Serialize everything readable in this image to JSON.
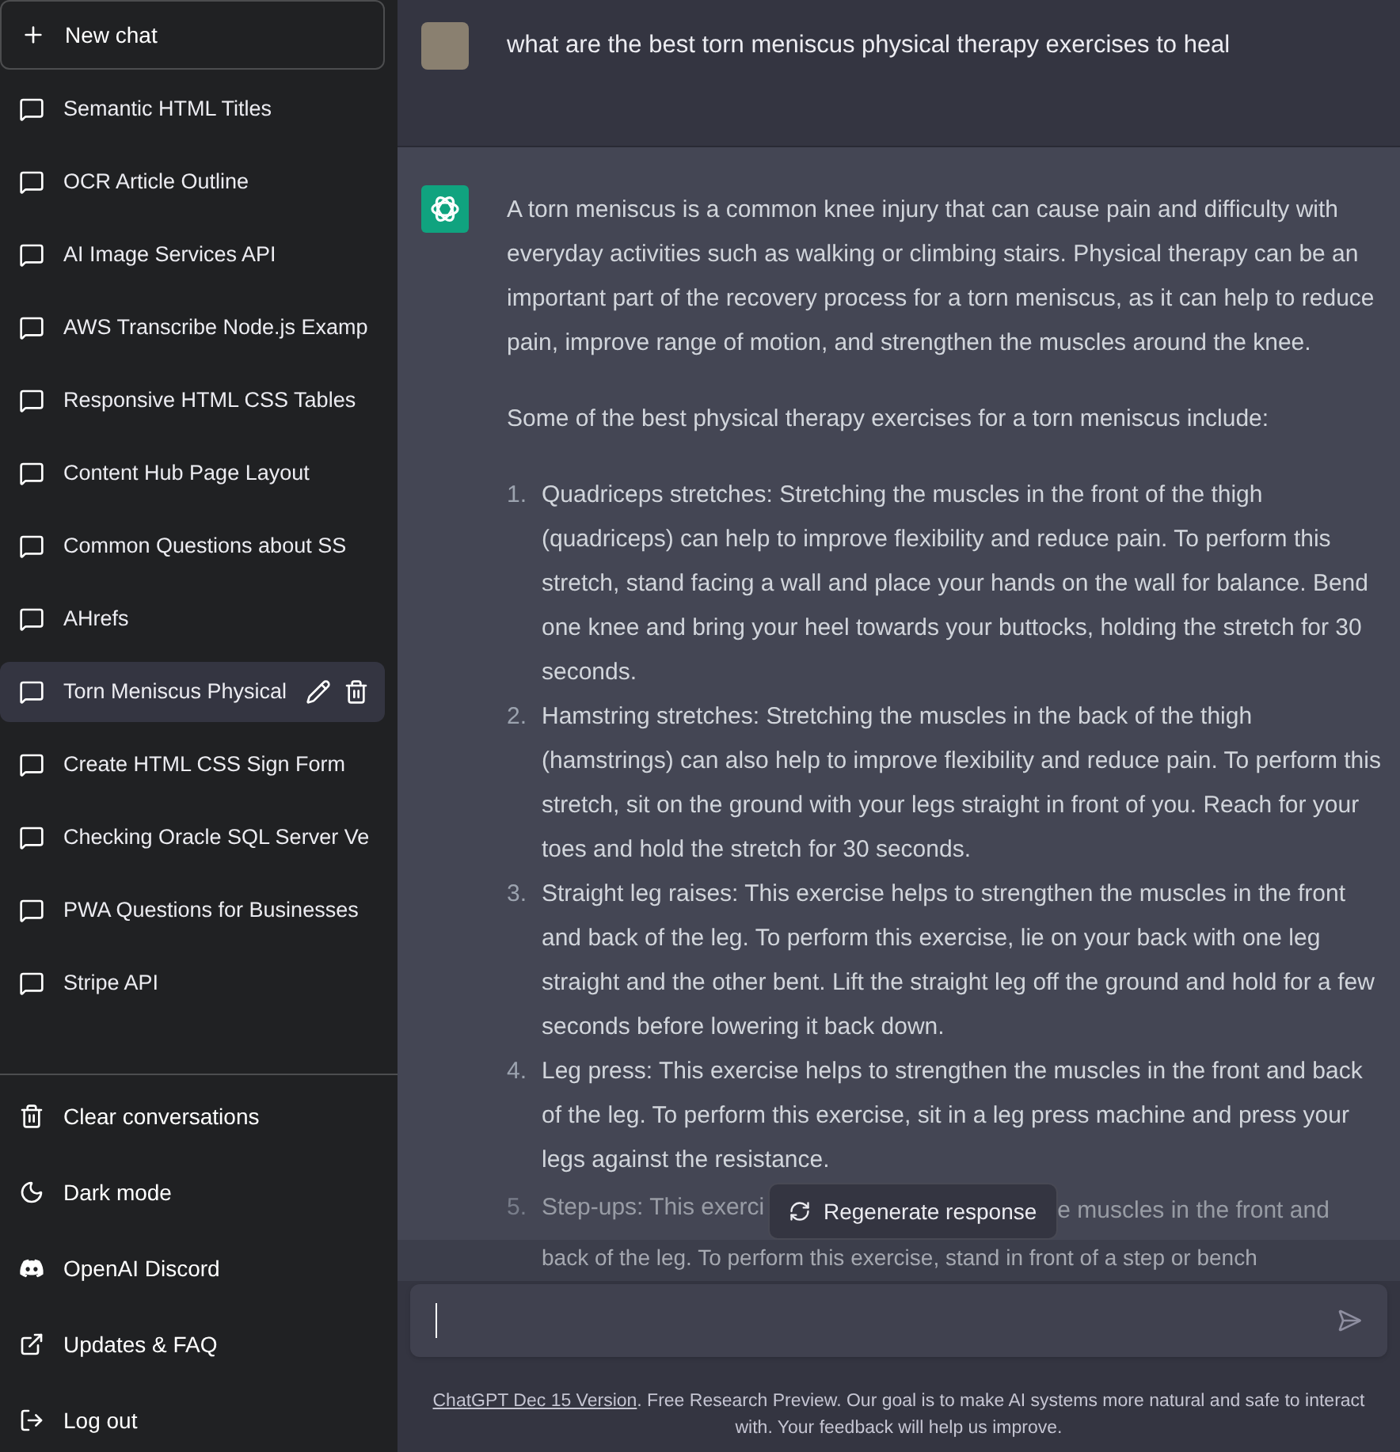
{
  "sidebar": {
    "new_chat": "New chat",
    "conversations": [
      {
        "title": "Semantic HTML Titles",
        "selected": false
      },
      {
        "title": "OCR Article Outline",
        "selected": false
      },
      {
        "title": "AI Image Services API",
        "selected": false
      },
      {
        "title": "AWS Transcribe Node.js Examp",
        "selected": false
      },
      {
        "title": "Responsive HTML CSS Tables",
        "selected": false
      },
      {
        "title": "Content Hub Page Layout",
        "selected": false
      },
      {
        "title": "Common Questions about SS",
        "selected": false
      },
      {
        "title": "AHrefs",
        "selected": false
      },
      {
        "title": "Torn Meniscus Physical",
        "selected": true
      },
      {
        "title": "Create HTML CSS Sign Form",
        "selected": false
      },
      {
        "title": "Checking Oracle SQL Server Ve",
        "selected": false
      },
      {
        "title": "PWA Questions for Businesses",
        "selected": false
      },
      {
        "title": "Stripe API",
        "selected": false
      }
    ],
    "menu": [
      {
        "label": "Clear conversations",
        "kind": "trash"
      },
      {
        "label": "Dark mode",
        "kind": "moon"
      },
      {
        "label": "OpenAI Discord",
        "kind": "discord"
      },
      {
        "label": "Updates & FAQ",
        "kind": "external"
      },
      {
        "label": "Log out",
        "kind": "logout"
      }
    ]
  },
  "chat": {
    "user_message": "what are the best torn meniscus physical therapy exercises to heal",
    "answer_paragraphs": [
      "A torn meniscus is a common knee injury that can cause pain and difficulty with everyday activities such as walking or climbing stairs. Physical therapy can be an important part of the recovery process for a torn meniscus, as it can help to reduce pain, improve range of motion, and strengthen the muscles around the knee.",
      "Some of the best physical therapy exercises for a torn meniscus include:"
    ],
    "answer_list": [
      {
        "number": "1.",
        "text": "Quadriceps stretches: Stretching the muscles in the front of the thigh (quadriceps) can help to improve flexibility and reduce pain. To perform this stretch, stand facing a wall and place your hands on the wall for balance. Bend one knee and bring your heel towards your buttocks, holding the stretch for 30 seconds."
      },
      {
        "number": "2.",
        "text": "Hamstring stretches: Stretching the muscles in the back of the thigh (hamstrings) can also help to improve flexibility and reduce pain. To perform this stretch, sit on the ground with your legs straight in front of you. Reach for your toes and hold the stretch for 30 seconds."
      },
      {
        "number": "3.",
        "text": "Straight leg raises: This exercise helps to strengthen the muscles in the front and back of the leg. To perform this exercise, lie on your back with one leg straight and the other bent. Lift the straight leg off the ground and hold for a few seconds before lowering it back down."
      },
      {
        "number": "4.",
        "text": "Leg press: This exercise helps to strengthen the muscles in the front and back of the leg. To perform this exercise, sit in a leg press machine and press your legs against the resistance."
      }
    ],
    "partial_item": {
      "number": "5.",
      "parts": [
        "Step-ups: This exerci",
        "e muscles in the front and"
      ],
      "next_line": "back of the leg. To perform this exercise, stand in front of a step or bench"
    },
    "regenerate": "Regenerate response",
    "footer": {
      "link": "ChatGPT Dec 15 Version",
      "text": ". Free Research Preview. Our goal is to make AI systems more natural and safe to interact with. Your feedback will help us improve."
    }
  }
}
